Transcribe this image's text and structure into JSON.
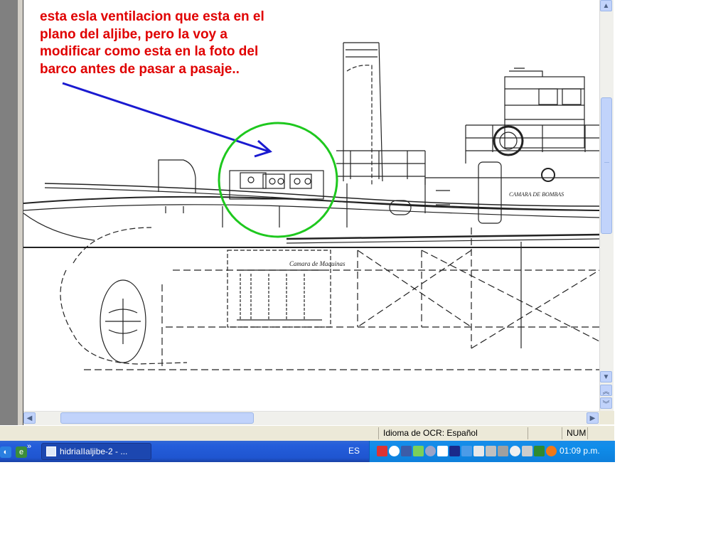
{
  "annotation": {
    "lines": [
      "esta esla ventilacion que esta en el",
      "plano del aljibe, pero la voy a",
      "modificar como esta en la foto del",
      "barco antes de pasar a pasaje.."
    ]
  },
  "drawing": {
    "label_pump_room": "CAMARA DE BOMBAS",
    "label_engine_room": "Camara de Maquinas",
    "highlight_color": "#1ec81e",
    "arrow_color": "#1a1ad0"
  },
  "statusbar": {
    "ocr_language": "Idioma de OCR: Español",
    "num_indicator": "NUM"
  },
  "taskbar": {
    "task_label": "hidriaIIaljibe-2 - ...",
    "language": "ES",
    "clock": "01:09 p.m."
  },
  "colors": {
    "taskbar": "#245edb",
    "tray": "#0f8dea",
    "annotation_text": "#e00000"
  }
}
